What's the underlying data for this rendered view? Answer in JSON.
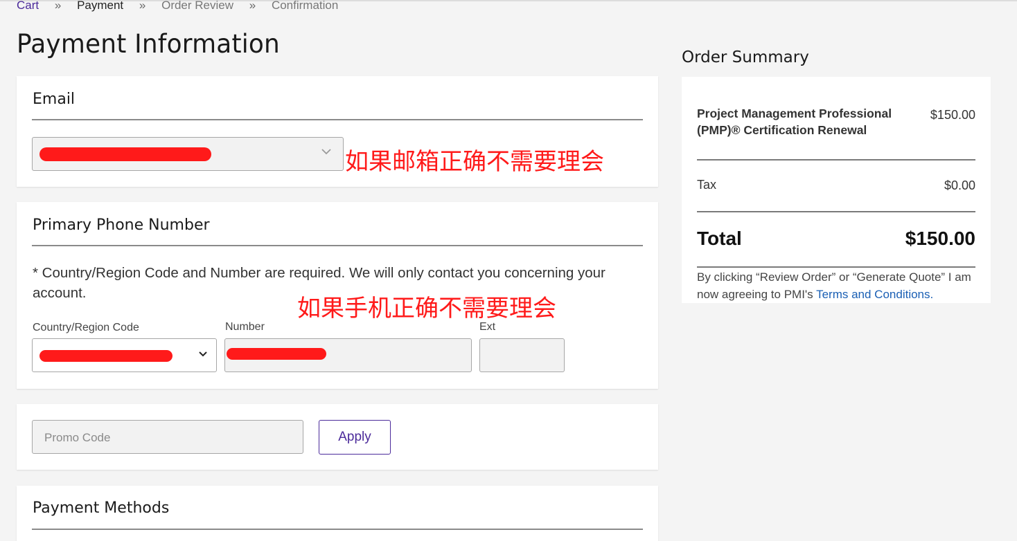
{
  "breadcrumb": {
    "cart": "Cart",
    "sep": "»",
    "payment": "Payment",
    "review": "Order Review",
    "confirmation": "Confirmation"
  },
  "page_title": "Payment Information",
  "email": {
    "heading": "Email",
    "annotation": "如果邮箱正确不需要理会"
  },
  "phone": {
    "heading": "Primary Phone Number",
    "note": "* Country/Region Code and Number are required. We will only contact you concerning your account.",
    "annotation": "如果手机正确不需要理会",
    "country_label": "Country/Region Code",
    "number_label": "Number",
    "ext_label": "Ext"
  },
  "promo": {
    "placeholder": "Promo Code",
    "apply_label": "Apply"
  },
  "payment_methods": {
    "heading": "Payment Methods"
  },
  "order_summary": {
    "title": "Order Summary",
    "item_name": "Project Management Professional (PMP)® Certification Renewal",
    "item_price": "$150.00",
    "tax_label": "Tax",
    "tax_value": "$0.00",
    "total_label": "Total",
    "total_value": "$150.00",
    "legal_text": "By clicking “Review Order” or “Generate Quote” I am now agreeing to PMI's",
    "terms_link": "Terms and Conditions."
  },
  "colors": {
    "background": "#f4f4f4",
    "accent_purple": "#4b2a9a",
    "link_blue": "#1a5fb4",
    "redaction_red": "#ff1a1a"
  }
}
